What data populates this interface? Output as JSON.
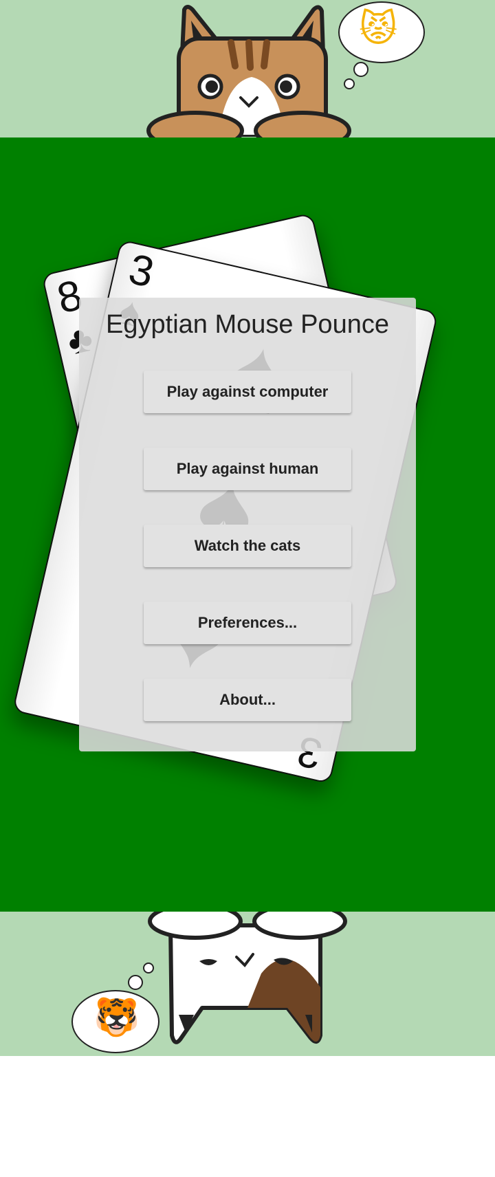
{
  "app": {
    "title": "Egyptian Mouse Pounce"
  },
  "menu": {
    "buttons": [
      {
        "label": "Play against computer"
      },
      {
        "label": "Play against human"
      },
      {
        "label": "Watch the cats"
      },
      {
        "label": "Preferences..."
      },
      {
        "label": "About..."
      }
    ]
  },
  "cards": {
    "back_card": {
      "rank": "8",
      "suit": "clubs"
    },
    "front_card": {
      "rank": "3",
      "suit": "spades"
    }
  },
  "players": {
    "top": {
      "avatar": "tabby-cat",
      "thought": "angry-cat-face-icon"
    },
    "bottom": {
      "avatar": "calico-cat",
      "thought": "tiger-face-icon"
    }
  },
  "colors": {
    "table": "#008000",
    "band": "#b4d9b4",
    "menu_bg": "#dcdcdc",
    "button_bg": "#e2e2e2"
  }
}
